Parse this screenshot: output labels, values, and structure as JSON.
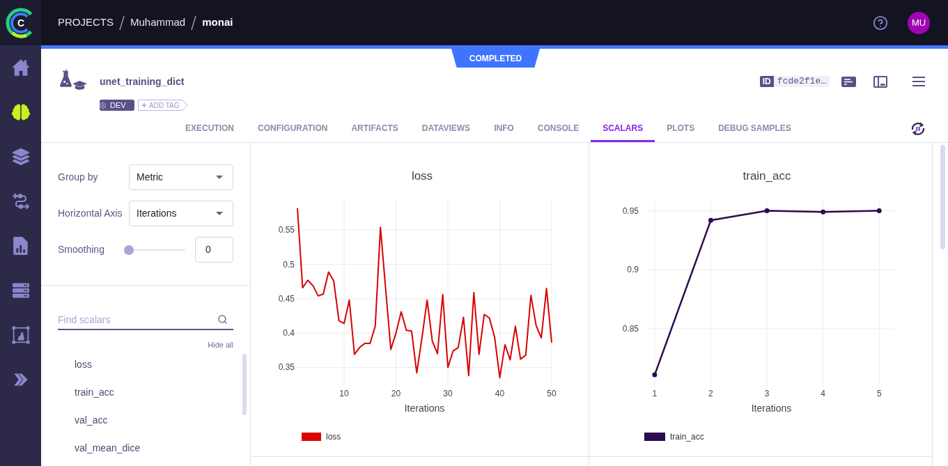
{
  "logo": {
    "letter": "C"
  },
  "sidebar": {
    "items": [
      {
        "selected": false
      },
      {
        "selected": true
      },
      {
        "selected": false
      },
      {
        "selected": false
      },
      {
        "selected": false
      },
      {
        "selected": false
      },
      {
        "selected": false
      },
      {
        "selected": false
      }
    ]
  },
  "top_bar": {
    "breadcrumbs": [
      {
        "label": "PROJECTS",
        "current": false
      },
      {
        "label": "Muhammad",
        "current": false
      },
      {
        "label": "monai",
        "current": true
      }
    ],
    "avatar": "MU"
  },
  "status_badge": "COMPLETED",
  "experiment": {
    "title": "unet_training_dict",
    "tags": [
      "DEV"
    ],
    "add_tag": "ADD TAG",
    "id_label": "ID",
    "id_value": "fcde2f1e…"
  },
  "tabs": [
    {
      "label": "EXECUTION",
      "selected": false
    },
    {
      "label": "CONFIGURATION",
      "selected": false
    },
    {
      "label": "ARTIFACTS",
      "selected": false
    },
    {
      "label": "DATAVIEWS",
      "selected": false
    },
    {
      "label": "INFO",
      "selected": false
    },
    {
      "label": "CONSOLE",
      "selected": false
    },
    {
      "label": "SCALARS",
      "selected": true
    },
    {
      "label": "PLOTS",
      "selected": false
    },
    {
      "label": "DEBUG SAMPLES",
      "selected": false
    }
  ],
  "scalars_panel": {
    "group_by": {
      "label": "Group by",
      "value": "Metric"
    },
    "horizontal_axis": {
      "label": "Horizontal Axis",
      "value": "Iterations"
    },
    "smoothing": {
      "label": "Smoothing",
      "level": 0,
      "value": "0"
    },
    "search": {
      "placeholder": "Find scalars"
    },
    "hide_all": "Hide all",
    "metrics": [
      "loss",
      "train_acc",
      "val_acc",
      "val_mean_dice"
    ]
  },
  "charts": [
    {
      "chart_data": {
        "type": "line",
        "title": "loss",
        "xlabel": "Iterations",
        "x": [
          1,
          2,
          3,
          4,
          5,
          6,
          7,
          8,
          9,
          10,
          11,
          12,
          13,
          14,
          15,
          16,
          17,
          18,
          19,
          20,
          21,
          22,
          23,
          24,
          25,
          26,
          27,
          28,
          29,
          30,
          31,
          32,
          33,
          34,
          35,
          36,
          37,
          38,
          39,
          40,
          41,
          42,
          43,
          44,
          45,
          46,
          47,
          48,
          49,
          50
        ],
        "series": [
          {
            "name": "loss",
            "color": "#d90000",
            "values": [
              0.582,
              0.466,
              0.477,
              0.469,
              0.454,
              0.457,
              0.489,
              0.476,
              0.418,
              0.414,
              0.448,
              0.369,
              0.379,
              0.385,
              0.385,
              0.41,
              0.554,
              0.465,
              0.376,
              0.4,
              0.431,
              0.404,
              0.403,
              0.342,
              0.393,
              0.448,
              0.388,
              0.37,
              0.456,
              0.35,
              0.374,
              0.379,
              0.423,
              0.338,
              0.459,
              0.369,
              0.427,
              0.422,
              0.394,
              0.335,
              0.383,
              0.361,
              0.41,
              0.362,
              0.368,
              0.455,
              0.411,
              0.393,
              0.465,
              0.386
            ]
          }
        ],
        "xlim": [
          1,
          50
        ],
        "ylim": [
          0.322,
          0.596
        ],
        "xticks": [
          10,
          20,
          30,
          40,
          50
        ],
        "yticks": [
          0.35,
          0.4,
          0.45,
          0.5,
          0.55
        ],
        "grid": true
      }
    },
    {
      "chart_data": {
        "type": "line",
        "title": "train_acc",
        "xlabel": "Iterations",
        "x": [
          1,
          2,
          3,
          4,
          5
        ],
        "series": [
          {
            "name": "train_acc",
            "color": "#2c0b4f",
            "marker": true,
            "values": [
              0.811,
              0.942,
              0.95,
              0.949,
              0.95
            ]
          }
        ],
        "xlim": [
          0.89,
          5.27
        ],
        "ylim": [
          0.801,
          0.9604
        ],
        "xticks": [
          1,
          2,
          3,
          4,
          5
        ],
        "yticks": [
          0.85,
          0.9,
          0.95
        ],
        "grid": true
      }
    }
  ]
}
